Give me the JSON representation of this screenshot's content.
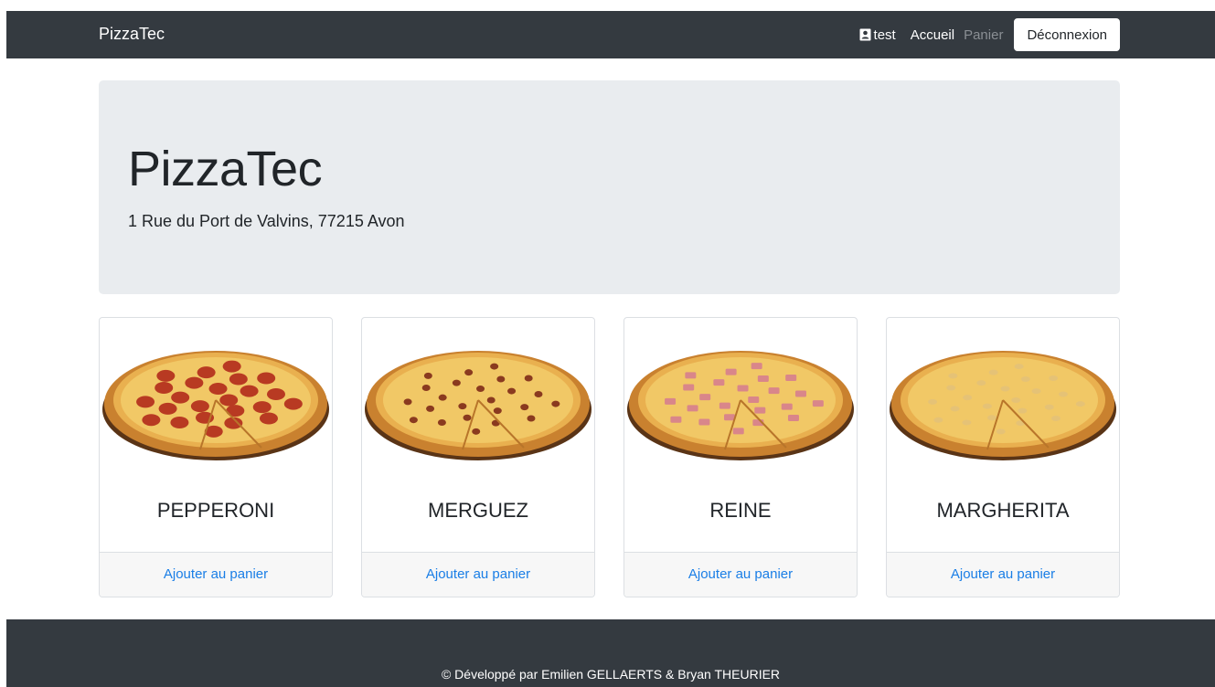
{
  "navbar": {
    "brand": "PizzaTec",
    "user_label": "test",
    "user_icon": "user-badge-icon",
    "links": [
      {
        "label": "Accueil",
        "state": "active"
      },
      {
        "label": "Panier",
        "state": "disabled"
      }
    ],
    "logout_label": "Déconnexion"
  },
  "jumbotron": {
    "title": "PizzaTec",
    "address": "1 Rue du Port de Valvins, 77215 Avon"
  },
  "products": [
    {
      "name": "PEPPERONI",
      "action": "Ajouter au panier",
      "topping": "pepperoni",
      "topping_color": "#b83a22"
    },
    {
      "name": "MERGUEZ",
      "action": "Ajouter au panier",
      "topping": "merguez",
      "topping_color": "#8a3a1f"
    },
    {
      "name": "REINE",
      "action": "Ajouter au panier",
      "topping": "ham",
      "topping_color": "#d9868a"
    },
    {
      "name": "MARGHERITA",
      "action": "Ajouter au panier",
      "topping": "cheese",
      "topping_color": "#e2c07a"
    }
  ],
  "footer": {
    "text": "© Développé par Emilien GELLAERTS & Bryan THEURIER"
  },
  "colors": {
    "navbar_bg": "#343a40",
    "jumbotron_bg": "#e9ecef",
    "link": "#1a7ee6"
  }
}
